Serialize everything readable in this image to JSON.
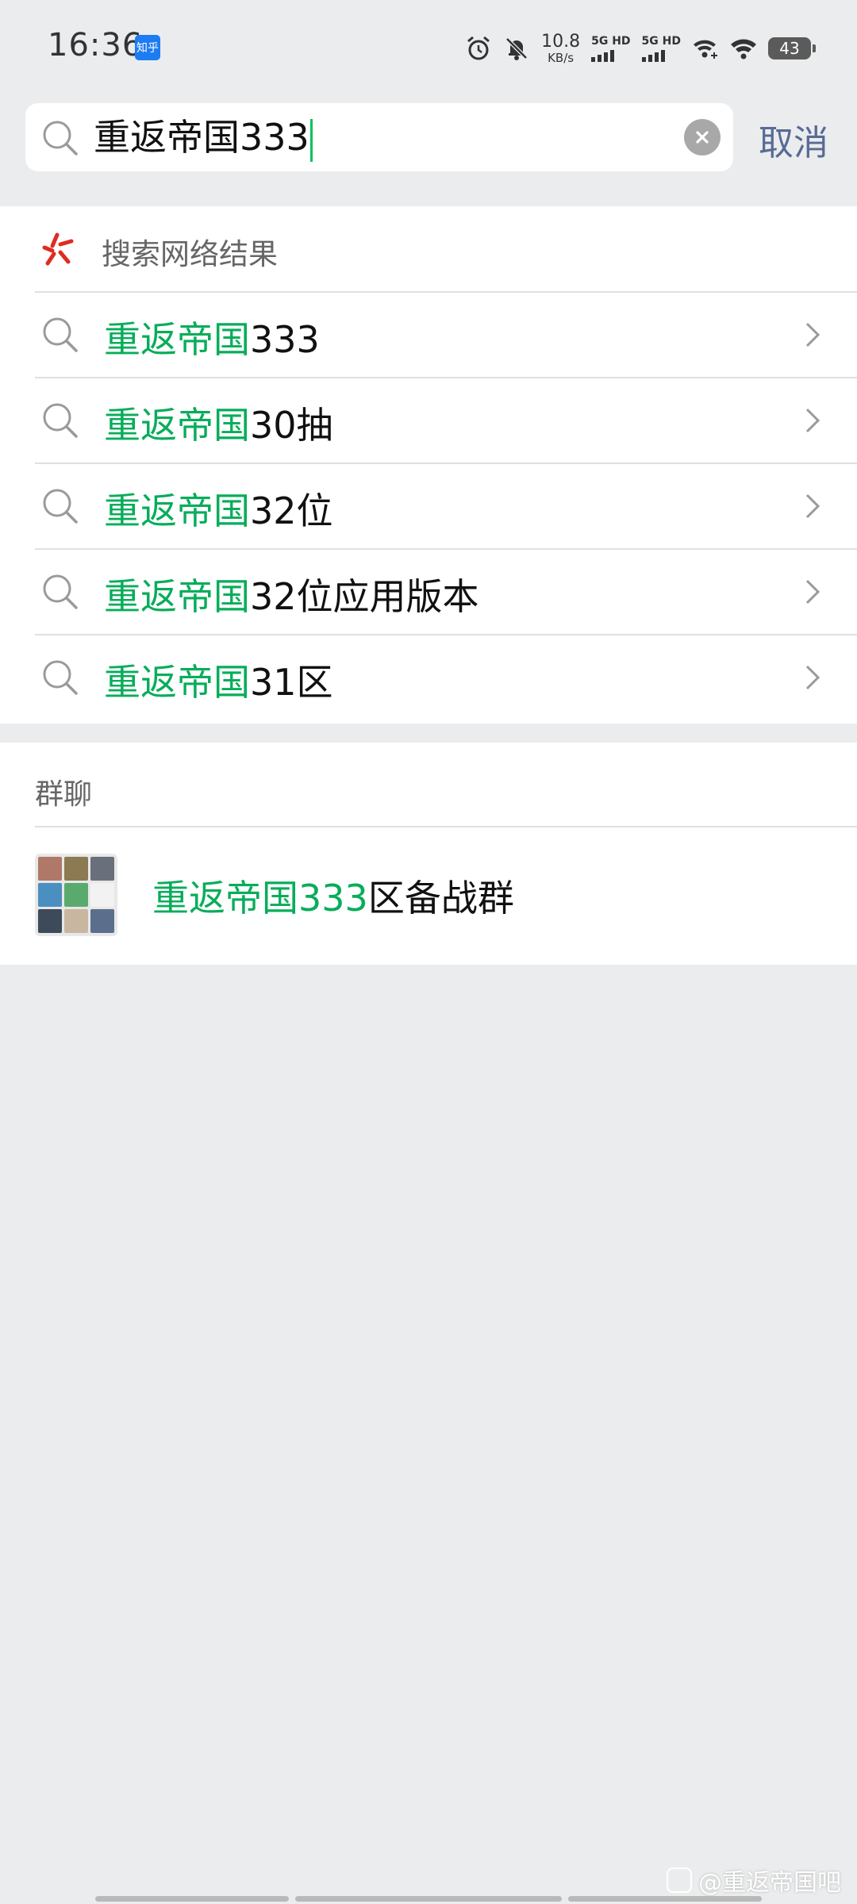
{
  "status_bar": {
    "time": "16:36",
    "app_badge": "知乎",
    "net_speed_value": "10.8",
    "net_speed_unit": "KB/s",
    "sim1_label": "5G HD",
    "sim2_label": "5G HD",
    "battery": "43"
  },
  "search": {
    "query": "重返帝国333",
    "cancel_label": "取消"
  },
  "web_results": {
    "header": "搜索网络结果",
    "items": [
      {
        "match": "重返帝国",
        "rest": "333"
      },
      {
        "match": "重返帝国",
        "rest": "30抽"
      },
      {
        "match": "重返帝国",
        "rest": "32位"
      },
      {
        "match": "重返帝国",
        "rest": "32位应用版本"
      },
      {
        "match": "重返帝国",
        "rest": "31区"
      }
    ]
  },
  "group_chats": {
    "header": "群聊",
    "items": [
      {
        "match": "重返帝国333",
        "rest": "区备战群"
      }
    ]
  },
  "watermark": "@重返帝国吧",
  "colors": {
    "highlight": "#07ad5a",
    "caret": "#07c160",
    "cancel": "#576b95",
    "background": "#ebeced"
  }
}
